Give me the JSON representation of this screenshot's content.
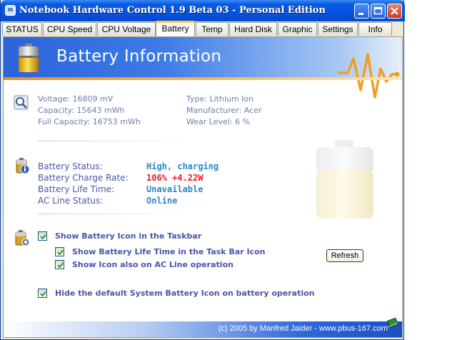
{
  "window": {
    "title": "Notebook Hardware Control 1.9 Beta 03  -  Personal Edition"
  },
  "tabs": [
    {
      "label": "STATUS"
    },
    {
      "label": "CPU Speed"
    },
    {
      "label": "CPU Voltage"
    },
    {
      "label": "Battery",
      "active": true
    },
    {
      "label": "Temp"
    },
    {
      "label": "Hard Disk"
    },
    {
      "label": "Graphic"
    },
    {
      "label": "Settings"
    },
    {
      "label": "Info"
    }
  ],
  "banner": {
    "title": "Battery Information",
    "icon": "battery-icon",
    "pulse_icon": "heartbeat-icon"
  },
  "info": {
    "voltage": "Voltage:  16809 mV",
    "capacity": "Capacity:  15643 mWh",
    "full_capacity": "Full Capacity:  16753 mWh",
    "type": "Type:  Lithium Ion",
    "manufacturer": "Manufacturer:  Acer",
    "wear_level": "Wear Level:  6 %"
  },
  "status": {
    "battery_status_label": "Battery Status:",
    "battery_status_value": "High, charging",
    "charge_rate_label": "Battery Charge Rate:",
    "charge_rate_value": "106%  +4.22W",
    "life_time_label": "Battery Life Time:",
    "life_time_value": "Unavailable",
    "ac_line_label": "AC Line Status:",
    "ac_line_value": "Online"
  },
  "options": {
    "show_taskbar_icon": "Show Battery Icon in the Taskbar",
    "show_life_time": "Show Battery Life Time in the Task Bar Icon",
    "show_on_ac": "Show Icon also on AC Line operation",
    "hide_default": "Hide the default System Battery Icon on battery operation",
    "refresh_label": "Refresh"
  },
  "footer": {
    "text": "(c) 2005 by Manfred Jaider  -  www.pbus-167.com"
  },
  "colors": {
    "accent_blue": "#0554e2",
    "status_blue": "#2a86c8",
    "status_red": "#e0202a",
    "label_purple": "#4a55a8",
    "banner_orange": "#e98a1b"
  }
}
